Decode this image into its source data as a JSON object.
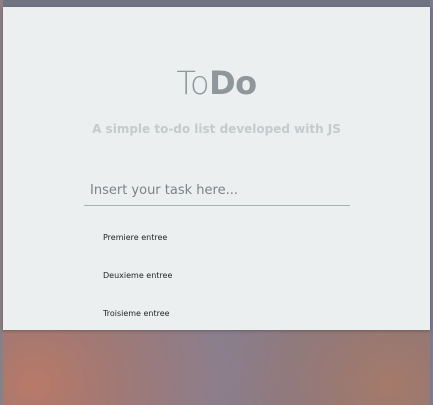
{
  "app": {
    "title_light": "To",
    "title_bold": "Do",
    "subtitle": "A simple to-do list developed with JS"
  },
  "task_input": {
    "placeholder": "Insert your task here...",
    "value": ""
  },
  "tasks": [
    {
      "label": "Premiere entree"
    },
    {
      "label": "Deuxieme entree"
    },
    {
      "label": "Troisieme entree"
    }
  ],
  "colors": {
    "panel_background": "#ecefef",
    "title": "#8f979b",
    "subtitle": "#c5cacc",
    "input_underline": "#a9b0b3",
    "task_text": "#1f2224"
  }
}
